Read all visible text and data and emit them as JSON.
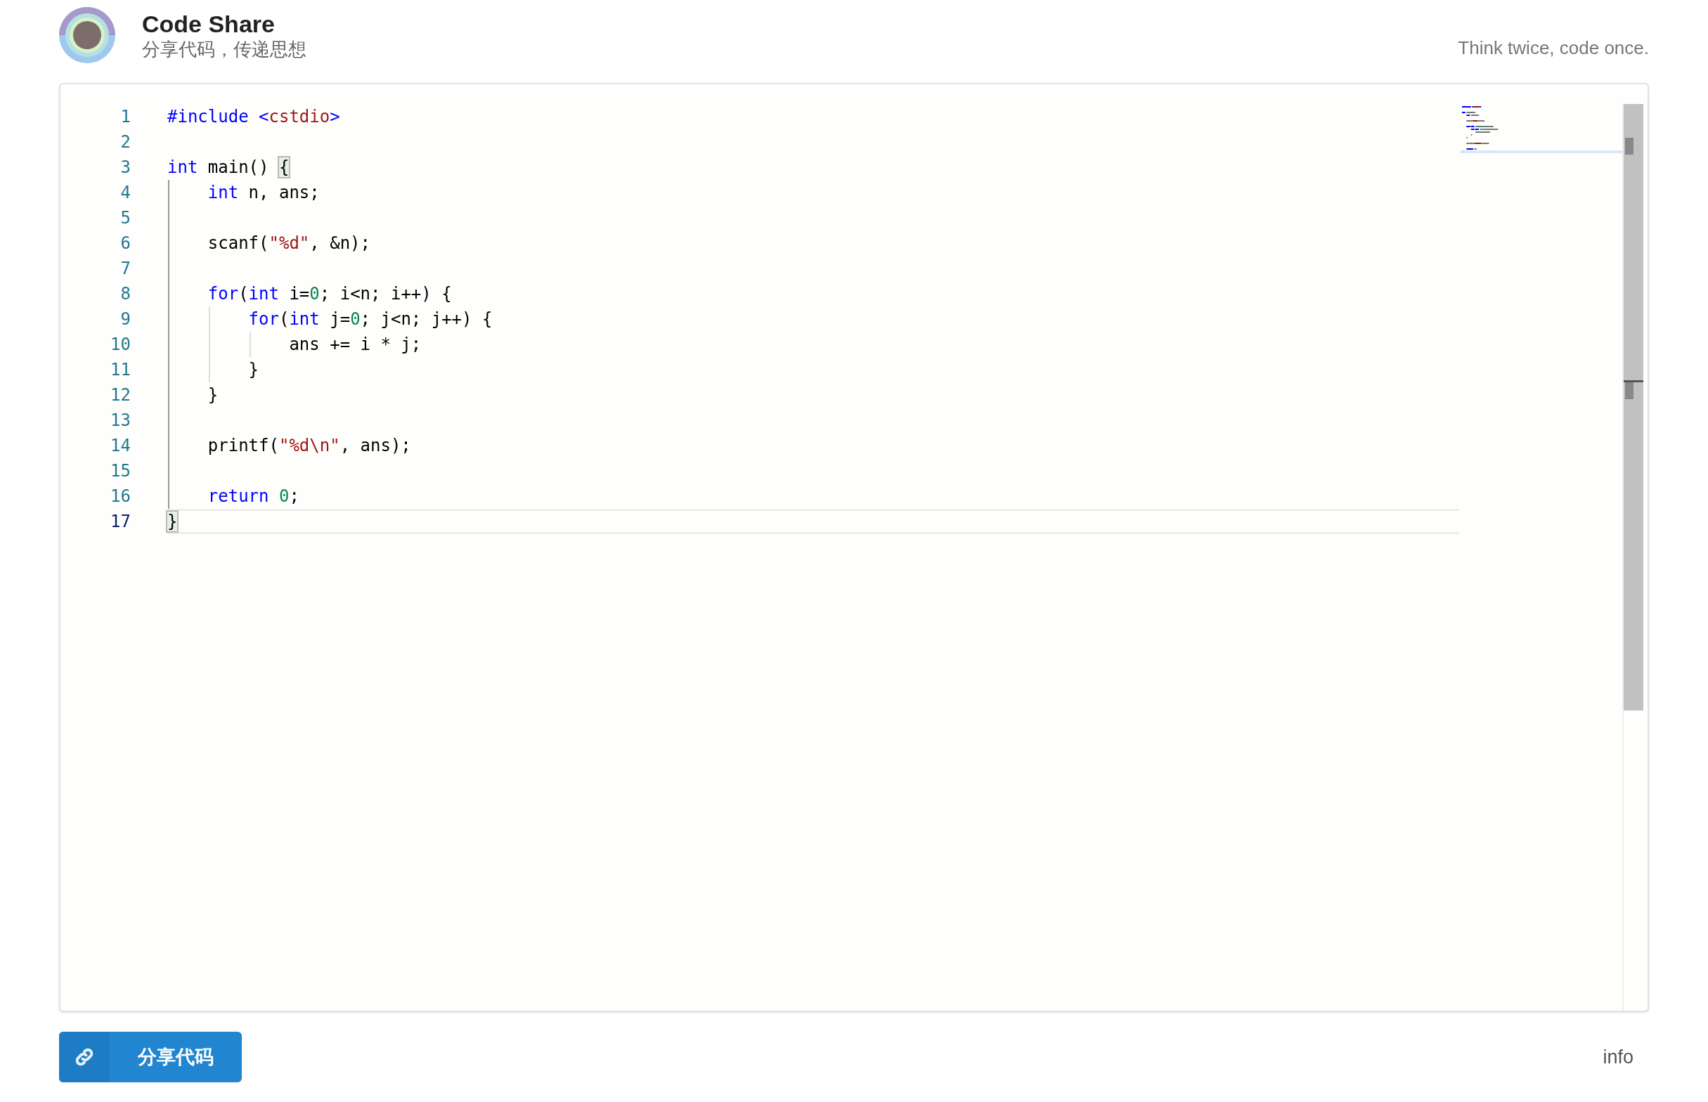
{
  "header": {
    "title": "Code Share",
    "subtitle": "分享代码，传递思想",
    "tagline": "Think twice, code once."
  },
  "editor": {
    "lines": [
      {
        "number": "1",
        "selected": false,
        "tokens": [
          {
            "kind": "keyword",
            "text": "#include"
          },
          {
            "kind": "keyword",
            "text": " <"
          },
          {
            "kind": "string",
            "text": "cstdio"
          },
          {
            "kind": "keyword",
            "text": ">"
          }
        ]
      },
      {
        "number": "2",
        "selected": false
      },
      {
        "number": "3",
        "selected": false,
        "tokens": [
          {
            "kind": "keyword",
            "text": "int"
          },
          {
            "kind": "plain",
            "text": " main() "
          },
          {
            "kind": "bracket",
            "text": "{"
          }
        ]
      },
      {
        "number": "4",
        "selected": false,
        "tokens": [
          {
            "kind": "keyword",
            "text": "    int"
          },
          {
            "kind": "plain",
            "text": " n, ans;"
          }
        ]
      },
      {
        "number": "5",
        "selected": false
      },
      {
        "number": "6",
        "selected": false,
        "tokens": [
          {
            "kind": "plain",
            "text": "    scanf("
          },
          {
            "kind": "string",
            "text": "\"%d\""
          },
          {
            "kind": "plain",
            "text": ", &n);"
          }
        ]
      },
      {
        "number": "7",
        "selected": false
      },
      {
        "number": "8",
        "selected": false,
        "tokens": [
          {
            "kind": "keyword",
            "text": "    for"
          },
          {
            "kind": "plain",
            "text": "("
          },
          {
            "kind": "keyword",
            "text": "int"
          },
          {
            "kind": "plain",
            "text": " i="
          },
          {
            "kind": "number",
            "text": "0"
          },
          {
            "kind": "plain",
            "text": "; i<n; i++) {"
          }
        ]
      },
      {
        "number": "9",
        "selected": false,
        "tokens": [
          {
            "kind": "keyword",
            "text": "        for"
          },
          {
            "kind": "plain",
            "text": "("
          },
          {
            "kind": "keyword",
            "text": "int"
          },
          {
            "kind": "plain",
            "text": " j="
          },
          {
            "kind": "number",
            "text": "0"
          },
          {
            "kind": "plain",
            "text": "; j<n; j++) {"
          }
        ]
      },
      {
        "number": "10",
        "selected": false,
        "tokens": [
          {
            "kind": "plain",
            "text": "            ans += i * j;"
          }
        ]
      },
      {
        "number": "11",
        "selected": false,
        "tokens": [
          {
            "kind": "plain",
            "text": "        }"
          }
        ]
      },
      {
        "number": "12",
        "selected": false,
        "tokens": [
          {
            "kind": "plain",
            "text": "    }"
          }
        ]
      },
      {
        "number": "13",
        "selected": false
      },
      {
        "number": "14",
        "selected": false,
        "tokens": [
          {
            "kind": "plain",
            "text": "    printf("
          },
          {
            "kind": "string",
            "text": "\"%d\\n\""
          },
          {
            "kind": "plain",
            "text": ", ans);"
          }
        ]
      },
      {
        "number": "15",
        "selected": false
      },
      {
        "number": "16",
        "selected": false,
        "tokens": [
          {
            "kind": "keyword",
            "text": "    return"
          },
          {
            "kind": "number",
            "text": " 0"
          },
          {
            "kind": "plain",
            "text": ";"
          }
        ]
      },
      {
        "number": "17",
        "selected": true,
        "tokens": [
          {
            "kind": "bracket",
            "text": "}"
          }
        ]
      }
    ]
  },
  "share_button": {
    "label": "分享代码"
  },
  "info_link": "info"
}
